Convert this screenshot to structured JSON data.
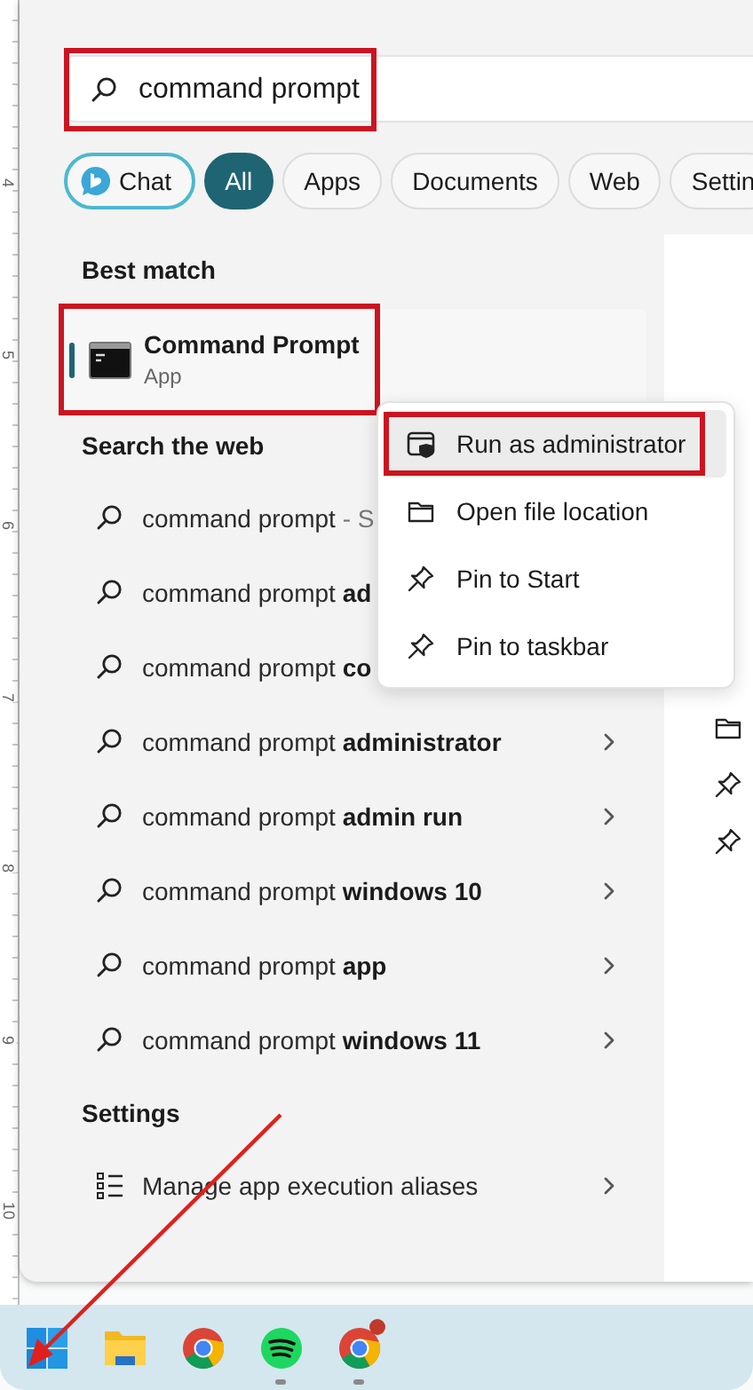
{
  "ruler": [
    "4",
    "5",
    "6",
    "7",
    "8",
    "9",
    "10"
  ],
  "search": {
    "value": "command prompt",
    "highlighted": true
  },
  "filters": [
    {
      "label": "Chat",
      "kind": "chat",
      "selected": false
    },
    {
      "label": "All",
      "kind": "text",
      "selected": true
    },
    {
      "label": "Apps",
      "kind": "text",
      "selected": false
    },
    {
      "label": "Documents",
      "kind": "text",
      "selected": false
    },
    {
      "label": "Web",
      "kind": "text",
      "selected": false
    },
    {
      "label": "Settin",
      "kind": "text",
      "selected": false
    }
  ],
  "best_match": {
    "heading": "Best match",
    "title": "Command Prompt",
    "subtitle": "App",
    "selected": true,
    "highlighted": true
  },
  "web": {
    "heading": "Search the web",
    "items": [
      {
        "text": "command prompt",
        "suffix": "- S"
      },
      {
        "text": "command prompt **ad**"
      },
      {
        "text": "command prompt **co**"
      },
      {
        "text": "command prompt **administrator**",
        "chevron": true
      },
      {
        "text": "command prompt **admin run**",
        "chevron": true
      },
      {
        "text": "command prompt **windows 10**",
        "chevron": true
      },
      {
        "text": "command prompt **app**",
        "chevron": true
      },
      {
        "text": "command prompt **windows 11**",
        "chevron": true
      }
    ]
  },
  "settings": {
    "heading": "Settings",
    "items": [
      {
        "text": "Manage app execution aliases",
        "chevron": true
      }
    ]
  },
  "context_menu": {
    "items": [
      {
        "label": "Run as administrator",
        "kind": "admin",
        "hovered": true,
        "highlighted": true
      },
      {
        "label": "Open file location",
        "kind": "folder",
        "hovered": false,
        "highlighted": false
      },
      {
        "label": "Pin to Start",
        "kind": "pin",
        "hovered": false,
        "highlighted": false
      },
      {
        "label": "Pin to taskbar",
        "kind": "pin",
        "hovered": false,
        "highlighted": false
      }
    ]
  },
  "taskbar": [
    {
      "kind": "start",
      "running": false,
      "badge": false
    },
    {
      "kind": "folder",
      "running": false,
      "badge": false
    },
    {
      "kind": "chrome",
      "running": false,
      "badge": false
    },
    {
      "kind": "spotify",
      "running": true,
      "badge": false
    },
    {
      "kind": "chrome",
      "running": true,
      "badge": true
    }
  ],
  "pointer_arrow": true
}
